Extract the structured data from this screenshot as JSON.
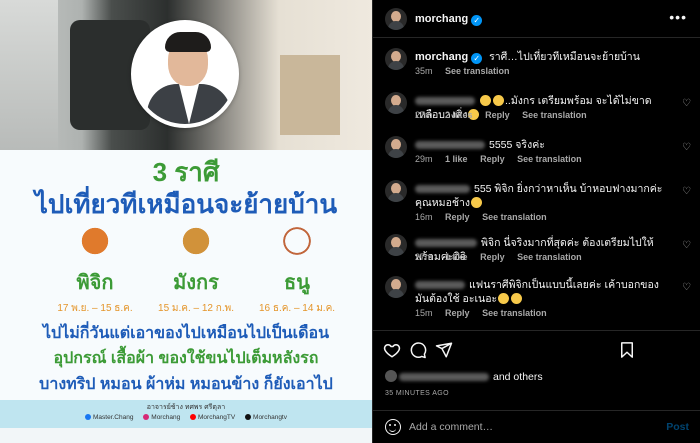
{
  "post_image": {
    "title_line_1": "3 ราศี",
    "title_line_2": "ไปเที่ยวทีเหมือนจะย้ายบ้าน",
    "zodiacs": [
      {
        "name": "พิจิก",
        "dates": "17 พ.ย. – 15 ธ.ค."
      },
      {
        "name": "มังกร",
        "dates": "15 ม.ค. – 12 ก.พ."
      },
      {
        "name": "ธนู",
        "dates": "16 ธ.ค. – 14 ม.ค."
      }
    ],
    "line_1": "ไปไม่กี่วันแต่เอาของไปเหมือนไปเป็นเดือน",
    "line_2": "อุปกรณ์ เสื้อผ้า ของใช้ขนไปเต็มหลังรถ",
    "line_3": "บางทริป หมอน ผ้าห่ม หมอนข้าง ก็ยังเอาไป",
    "footer_brand": "อาจารย์ช้าง ทศพร ศรีตุลา",
    "footer_socials": [
      "Master.Chang",
      "Morchang",
      "MorchangTV",
      "Morchangtv"
    ]
  },
  "header": {
    "username": "morchang"
  },
  "caption": {
    "username": "morchang",
    "text": "ราศี…ไปเที่ยวทีเหมือนจะย้ายบ้าน",
    "time": "35m",
    "see_translation": "See translation"
  },
  "comments": [
    {
      "text": "..มังกร เตรียมพร้อม จะได้ไม่ขาดเหลือบางสิ่ง",
      "time": "27m",
      "likes": "2 likes",
      "reply": "Reply",
      "see_translation": "See translation"
    },
    {
      "text": "5555 จริงค่ะ",
      "time": "29m",
      "likes": "1 like",
      "reply": "Reply",
      "see_translation": "See translation"
    },
    {
      "text": "555 พิจิก ยิ่งกว่าหาเห็น บ้าหอบฟางมากค่ะ คุณหมอช้าง",
      "time": "16m",
      "reply": "Reply",
      "see_translation": "See translation"
    },
    {
      "text": "พิจิก นี่จริงมากที่สุดค่ะ ต้องเตรียมไปให้พร้อมค่ะอิอิ",
      "time": "27m",
      "likes": "1 like",
      "reply": "Reply",
      "see_translation": "See translation"
    },
    {
      "text": "แฟนราศีพิจิกเป็นแบบนี้เลยค่ะ เค้าบอกของมันต้องใช้ อะเนอะ",
      "time": "15m",
      "reply": "Reply",
      "see_translation": "See translation"
    }
  ],
  "likes_line": {
    "suffix": "and others"
  },
  "time_ago": "35 MINUTES AGO",
  "add_comment": {
    "placeholder": "Add a comment…",
    "post_label": "Post"
  },
  "icons": {
    "like": "heart-icon",
    "comment": "comment-icon",
    "share": "share-icon",
    "save": "bookmark-icon",
    "more": "more-icon",
    "verified": "verified-badge-icon"
  },
  "colors": {
    "accent_blue": "#0095f6",
    "thai_green": "#3c9b36",
    "thai_blue": "#1e5cb8",
    "date_orange": "#e4952a"
  }
}
